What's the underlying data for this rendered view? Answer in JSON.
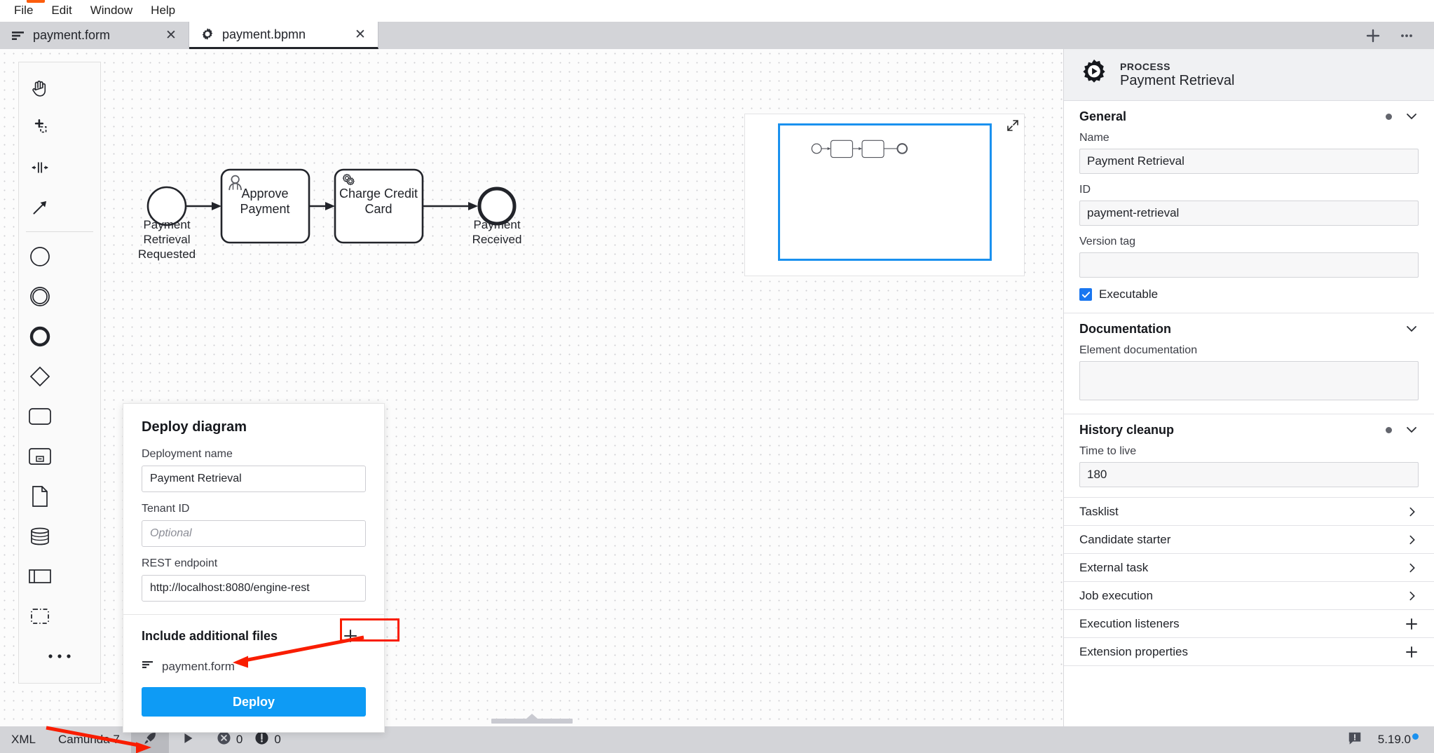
{
  "menubar": {
    "items": [
      "File",
      "Edit",
      "Window",
      "Help"
    ]
  },
  "tabs": {
    "items": [
      {
        "label": "payment.form",
        "icon": "form-icon",
        "active": false,
        "close_label": "✕"
      },
      {
        "label": "payment.bpmn",
        "icon": "gear-icon",
        "active": true,
        "close_label": "✕"
      }
    ],
    "new_tab_label": "+",
    "more_label": "…"
  },
  "palette": {
    "tools": [
      {
        "name": "hand-tool-icon"
      },
      {
        "name": "lasso-tool-icon"
      },
      {
        "name": "space-tool-icon"
      },
      {
        "name": "global-connect-tool-icon"
      }
    ],
    "elements": [
      {
        "name": "start-event-icon"
      },
      {
        "name": "intermediate-event-icon"
      },
      {
        "name": "end-event-icon"
      },
      {
        "name": "gateway-icon"
      },
      {
        "name": "task-icon"
      },
      {
        "name": "subprocess-icon"
      },
      {
        "name": "data-object-icon"
      },
      {
        "name": "data-store-icon"
      },
      {
        "name": "participant-icon"
      },
      {
        "name": "group-icon"
      }
    ],
    "more_label": "•••"
  },
  "diagram": {
    "nodes": [
      {
        "id": "start",
        "type": "start-event",
        "label": "Payment\nRetrieval\nRequested"
      },
      {
        "id": "approve",
        "type": "user-task",
        "label": "Approve\nPayment"
      },
      {
        "id": "charge",
        "type": "service-task",
        "label": "Charge Credit\nCard"
      },
      {
        "id": "end",
        "type": "end-event",
        "label": "Payment\nReceived"
      }
    ],
    "flows": [
      {
        "from": "start",
        "to": "approve"
      },
      {
        "from": "approve",
        "to": "charge"
      },
      {
        "from": "charge",
        "to": "end"
      }
    ],
    "labels": {
      "start_l1": "Payment",
      "start_l2": "Retrieval",
      "start_l3": "Requested",
      "approve_l1": "Approve",
      "approve_l2": "Payment",
      "charge_l1": "Charge Credit",
      "charge_l2": "Card",
      "end_l1": "Payment",
      "end_l2": "Received"
    }
  },
  "minimap": {
    "toggle_icon": "collapse-minimap-icon"
  },
  "deploy_dialog": {
    "title": "Deploy diagram",
    "deployment_name": {
      "label": "Deployment name",
      "value": "Payment Retrieval",
      "placeholder": ""
    },
    "tenant_id": {
      "label": "Tenant ID",
      "value": "",
      "placeholder": "Optional"
    },
    "rest_endpoint": {
      "label": "REST endpoint",
      "value": "http://localhost:8080/engine-rest",
      "placeholder": ""
    },
    "include_label": "Include additional files",
    "add_button_label": "+",
    "files": [
      {
        "name": "payment.form",
        "icon": "form-icon"
      }
    ],
    "deploy_button_label": "Deploy"
  },
  "properties": {
    "header": {
      "kind": "PROCESS",
      "name": "Payment Retrieval",
      "icon": "process-icon"
    },
    "general": {
      "title": "General",
      "name": {
        "label": "Name",
        "value": "Payment Retrieval"
      },
      "id": {
        "label": "ID",
        "value": "payment-retrieval"
      },
      "version_tag": {
        "label": "Version tag",
        "value": ""
      },
      "executable": {
        "label": "Executable",
        "checked": true
      }
    },
    "documentation": {
      "title": "Documentation",
      "element_documentation": {
        "label": "Element documentation",
        "value": ""
      }
    },
    "history_cleanup": {
      "title": "History cleanup",
      "time_to_live": {
        "label": "Time to live",
        "value": "180"
      }
    },
    "collapsed_groups": [
      {
        "label": "Tasklist",
        "action": "chevron-right-icon"
      },
      {
        "label": "Candidate starter",
        "action": "chevron-right-icon"
      },
      {
        "label": "External task",
        "action": "chevron-right-icon"
      },
      {
        "label": "Job execution",
        "action": "chevron-right-icon"
      },
      {
        "label": "Execution listeners",
        "action": "plus-icon"
      },
      {
        "label": "Extension properties",
        "action": "plus-icon"
      }
    ]
  },
  "statusbar": {
    "xml_label": "XML",
    "engine_label": "Camunda 7",
    "deploy_icon": "rocket-icon",
    "run_icon": "play-icon",
    "error_count": "0",
    "warning_count": "0",
    "feedback_icon": "feedback-icon",
    "version": "5.19.0"
  },
  "colors": {
    "accent_blue": "#0e9bf5",
    "annotation_red": "#f91d00",
    "minimap_viewport": "#1a91ef",
    "checkbox_blue": "#1976f0",
    "tabbar_bg": "#d3d4d8"
  }
}
